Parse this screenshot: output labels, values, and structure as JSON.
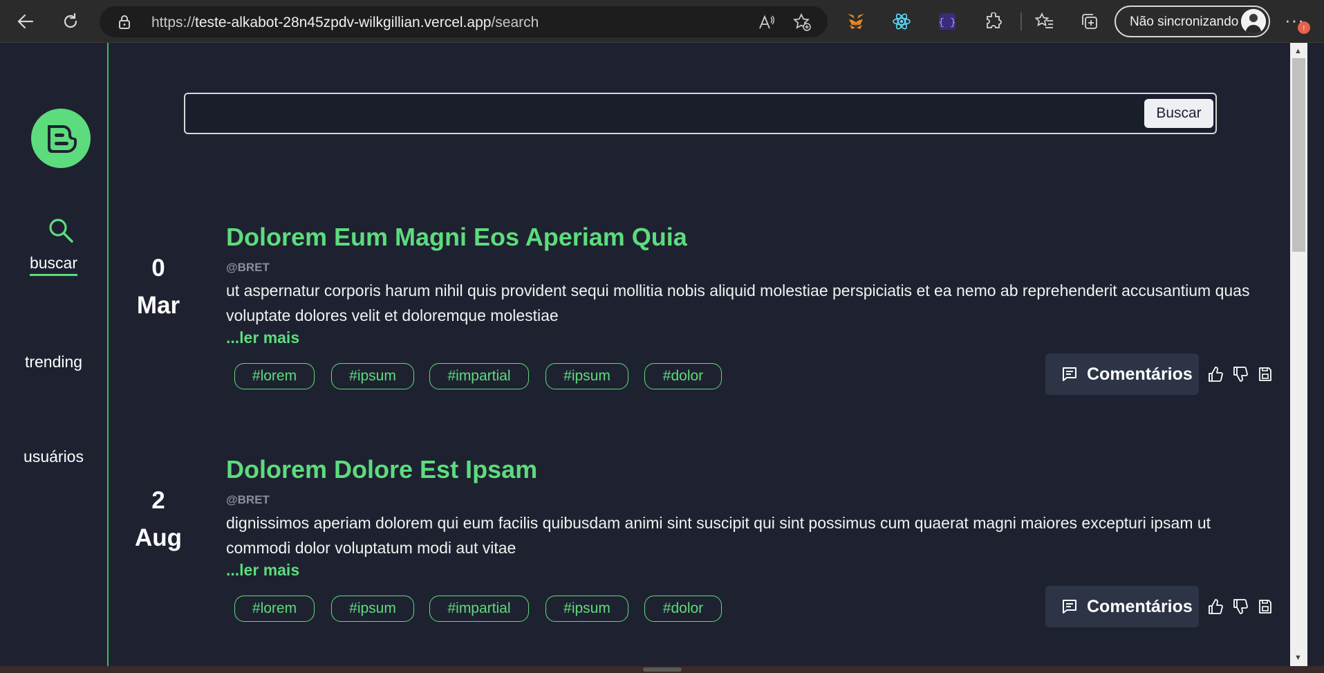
{
  "browser": {
    "url_scheme": "https://",
    "url_host": "teste-alkabot-28n45zpdv-wilkgillian.vercel.app",
    "url_path": "/search",
    "sync_label": "Não sincronizando",
    "notification_badge": "↑"
  },
  "sidebar": {
    "items": [
      {
        "label": "buscar",
        "icon": "search-icon",
        "active": true
      },
      {
        "label": "trending"
      },
      {
        "label": "usuários"
      }
    ]
  },
  "search": {
    "value": "",
    "button_label": "Buscar"
  },
  "posts": [
    {
      "day": "0",
      "month": "Mar",
      "title": "Dolorem Eum Magni Eos Aperiam Quia",
      "author": "@BRET",
      "body": "ut aspernatur corporis harum nihil quis provident sequi mollitia nobis aliquid molestiae perspiciatis et ea nemo ab reprehenderit accusantium quas voluptate dolores velit et doloremque molestiae",
      "read_more": "...ler mais",
      "tags": [
        "#lorem",
        "#ipsum",
        "#impartial",
        "#ipsum",
        "#dolor"
      ],
      "comments_label": "Comentários"
    },
    {
      "day": "2",
      "month": "Aug",
      "title": "Dolorem Dolore Est Ipsam",
      "author": "@BRET",
      "body": "dignissimos aperiam dolorem qui eum facilis quibusdam animi sint suscipit qui sint possimus cum quaerat magni maiores excepturi ipsam ut commodi dolor voluptatum modi aut vitae",
      "read_more": "...ler mais",
      "tags": [
        "#lorem",
        "#ipsum",
        "#impartial",
        "#ipsum",
        "#dolor"
      ],
      "comments_label": "Comentários"
    }
  ],
  "colors": {
    "accent": "#5ddc7d",
    "background": "#1e2230",
    "comments_bg": "#2c3446"
  }
}
